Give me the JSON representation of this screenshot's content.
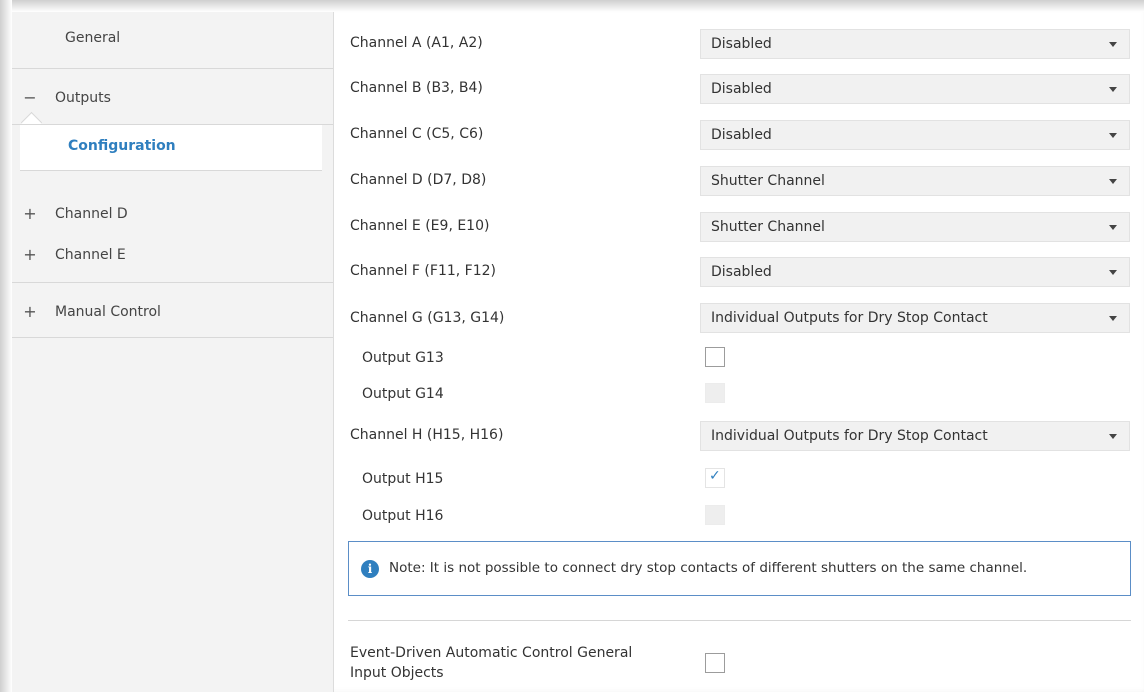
{
  "sidebar": {
    "general": "General",
    "outputs": {
      "symbol": "−",
      "label": "Outputs"
    },
    "configuration": "Configuration",
    "channel_d": {
      "symbol": "+",
      "label": "Channel D"
    },
    "channel_e": {
      "symbol": "+",
      "label": "Channel E"
    },
    "manual_control": {
      "symbol": "+",
      "label": "Manual Control"
    }
  },
  "main": {
    "channels": [
      {
        "label": "Channel A (A1, A2)",
        "value": "Disabled"
      },
      {
        "label": "Channel B (B3, B4)",
        "value": "Disabled"
      },
      {
        "label": "Channel C (C5, C6)",
        "value": "Disabled"
      },
      {
        "label": "Channel D (D7, D8)",
        "value": "Shutter Channel"
      },
      {
        "label": "Channel E (E9, E10)",
        "value": "Shutter Channel"
      },
      {
        "label": "Channel F (F11, F12)",
        "value": "Disabled"
      },
      {
        "label": "Channel G (G13, G14)",
        "value": "Individual Outputs for Dry Stop Contact"
      }
    ],
    "output_g13": {
      "label": "Output G13",
      "checked": false,
      "enabled": true
    },
    "output_g14": {
      "label": "Output G14",
      "checked": false,
      "enabled": false
    },
    "channel_h": {
      "label": "Channel H (H15, H16)",
      "value": "Individual Outputs for Dry Stop Contact"
    },
    "output_h15": {
      "label": "Output H15",
      "checked": true,
      "enabled": true,
      "mark": "✓"
    },
    "output_h16": {
      "label": "Output H16",
      "checked": false,
      "enabled": false
    },
    "note": {
      "icon": "i",
      "text": "Note: It is not possible to connect dry stop contacts of different shutters on the same channel."
    },
    "event_driven": {
      "label_line1": "Event-Driven Automatic Control General",
      "label_line2": "Input Objects",
      "checked": false
    }
  },
  "colors": {
    "accent": "#2f7fbf",
    "note_border": "#5b8ec7",
    "sidebar_bg": "#f3f3f3",
    "dropdown_bg": "#f1f1f1"
  }
}
